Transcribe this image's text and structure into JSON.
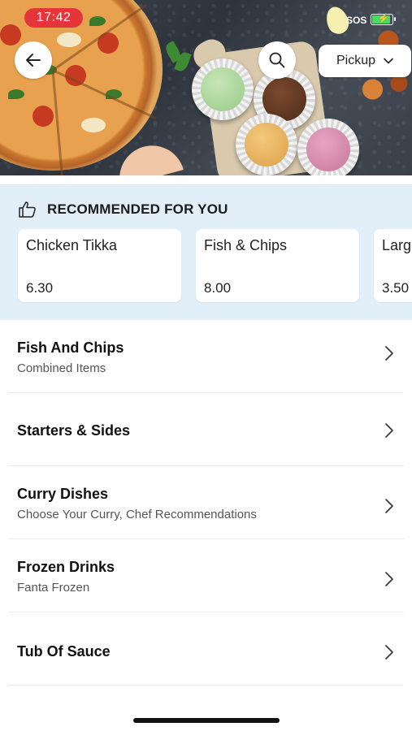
{
  "status_bar": {
    "time": "17:42",
    "sos": "SOS"
  },
  "header": {
    "back_icon": "arrow-left-icon",
    "search_icon": "search-icon",
    "order_mode": "Pickup",
    "order_mode_icon": "chevron-down-icon"
  },
  "recommended": {
    "icon": "thumbs-up-icon",
    "title": "RECOMMENDED FOR YOU",
    "items": [
      {
        "name": "Chicken Tikka",
        "price": "6.30"
      },
      {
        "name": "Fish & Chips",
        "price": "8.00"
      },
      {
        "name": "Larg",
        "price": "3.50"
      }
    ]
  },
  "categories": [
    {
      "title": "Fish And Chips",
      "subtitle": "Combined Items"
    },
    {
      "title": "Starters & Sides",
      "subtitle": ""
    },
    {
      "title": "Curry Dishes",
      "subtitle": "Choose Your Curry, Chef Recommendations"
    },
    {
      "title": "Frozen Drinks",
      "subtitle": "Fanta Frozen"
    },
    {
      "title": "Tub Of Sauce",
      "subtitle": ""
    }
  ],
  "colors": {
    "time_pill": "#e5343a",
    "recommended_bg": "#e2eef8",
    "battery": "#4cd964"
  }
}
